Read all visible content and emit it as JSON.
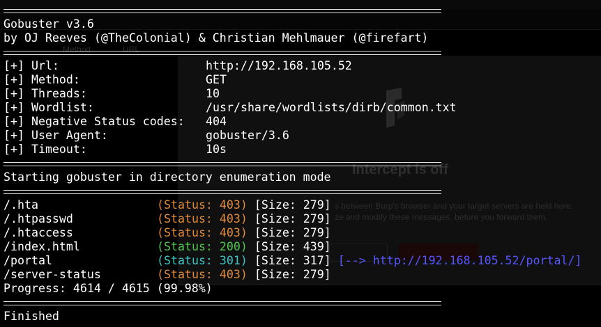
{
  "window": {
    "background_color": "#000000",
    "text_color": "#ffffff"
  },
  "banner": {
    "title": "Gobuster v3.6",
    "authors": "by OJ Reeves (@TheColonial) & Christian Mehlmauer (@firefart)"
  },
  "config": [
    {
      "key": "[+] Url:",
      "value": "http://192.168.105.52"
    },
    {
      "key": "[+] Method:",
      "value": "GET"
    },
    {
      "key": "[+] Threads:",
      "value": "10"
    },
    {
      "key": "[+] Wordlist:",
      "value": "/usr/share/wordlists/dirb/common.txt"
    },
    {
      "key": "[+] Negative Status codes:",
      "value": "404"
    },
    {
      "key": "[+] User Agent:",
      "value": "gobuster/3.6"
    },
    {
      "key": "[+] Timeout:",
      "value": "10s"
    }
  ],
  "start_message": "Starting gobuster in directory enumeration mode",
  "results": [
    {
      "path": "/.hta",
      "status_text": "(Status: 403)",
      "size_text": "[Size: 279]",
      "redirect": ""
    },
    {
      "path": "/.htpasswd",
      "status_text": "(Status: 403)",
      "size_text": "[Size: 279]",
      "redirect": ""
    },
    {
      "path": "/.htaccess",
      "status_text": "(Status: 403)",
      "size_text": "[Size: 279]",
      "redirect": ""
    },
    {
      "path": "/index.html",
      "status_text": "(Status: 200)",
      "size_text": "[Size: 439]",
      "redirect": ""
    },
    {
      "path": "/portal",
      "status_text": "(Status: 301)",
      "size_text": "[Size: 317]",
      "redirect": "[--> http://192.168.105.52/portal/]"
    },
    {
      "path": "/server-status",
      "status_text": "(Status: 403)",
      "size_text": "[Size: 279]",
      "redirect": ""
    }
  ],
  "status_colors": {
    "403": "#e28b3d",
    "200": "#4ec84e",
    "301": "#3fc5c5"
  },
  "redirect_color": "#5656ff",
  "progress": "Progress: 4614 / 4615 (99.98%)",
  "finished": "Finished",
  "background_app": {
    "column_method": "Method",
    "column_url": "URL",
    "intercept_title": "Intercept is off",
    "intercept_desc_1": "s between Burp's browser and your target servers are held here.",
    "intercept_desc_2": "ze and modify these messages, before you forward them."
  }
}
